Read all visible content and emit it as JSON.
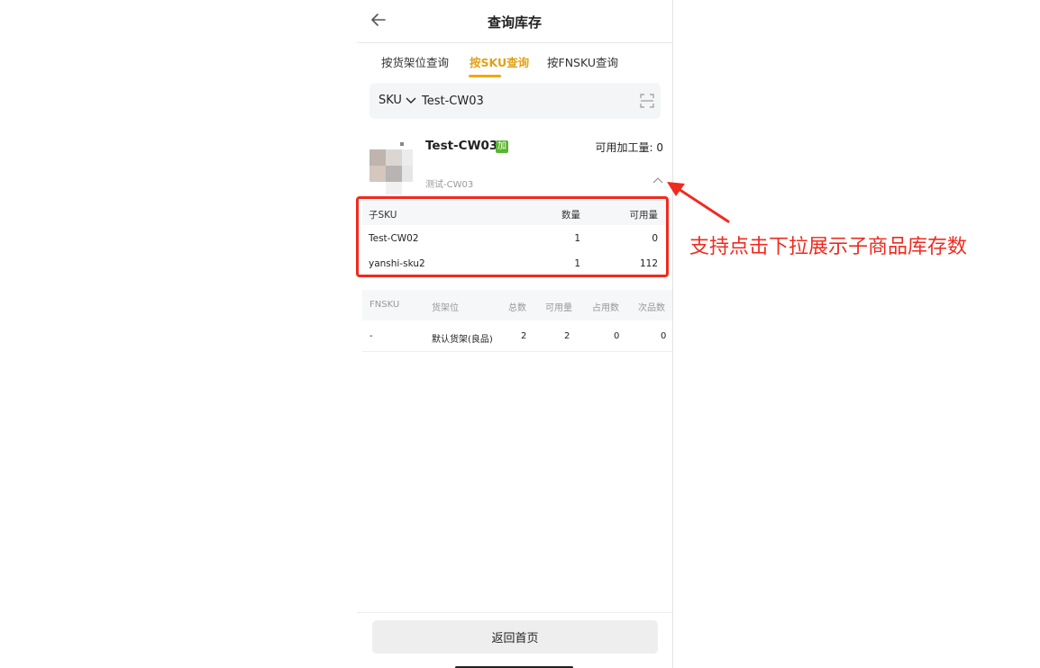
{
  "header": {
    "title": "查询库存"
  },
  "tabs": [
    {
      "label": "按货架位查询"
    },
    {
      "label": "按SKU查询"
    },
    {
      "label": "按FNSKU查询"
    }
  ],
  "search": {
    "type_label": "SKU",
    "value": "Test-CW03"
  },
  "product": {
    "name": "Test-CW03",
    "tag": "加",
    "available_processing": "可用加工量: 0",
    "subtitle": "测试-CW03"
  },
  "sub_table": {
    "headers": [
      "子SKU",
      "数量",
      "可用量"
    ],
    "rows": [
      [
        "Test-CW02",
        "1",
        "0"
      ],
      [
        "yanshi-sku2",
        "1",
        "112"
      ]
    ]
  },
  "fnsku_table": {
    "headers": [
      "FNSKU",
      "货架位",
      "总数",
      "可用量",
      "占用数",
      "次品数"
    ],
    "rows": [
      [
        "-",
        "默认货架(良品)",
        "2",
        "2",
        "0",
        "0"
      ]
    ]
  },
  "footer": {
    "button_label": "返回首页"
  },
  "annotation": {
    "text": "支持点击下拉展示子商品库存数"
  },
  "colors": {
    "accent": "#f0a80c",
    "annotation": "#f02a1e",
    "tag": "#5bb531"
  }
}
